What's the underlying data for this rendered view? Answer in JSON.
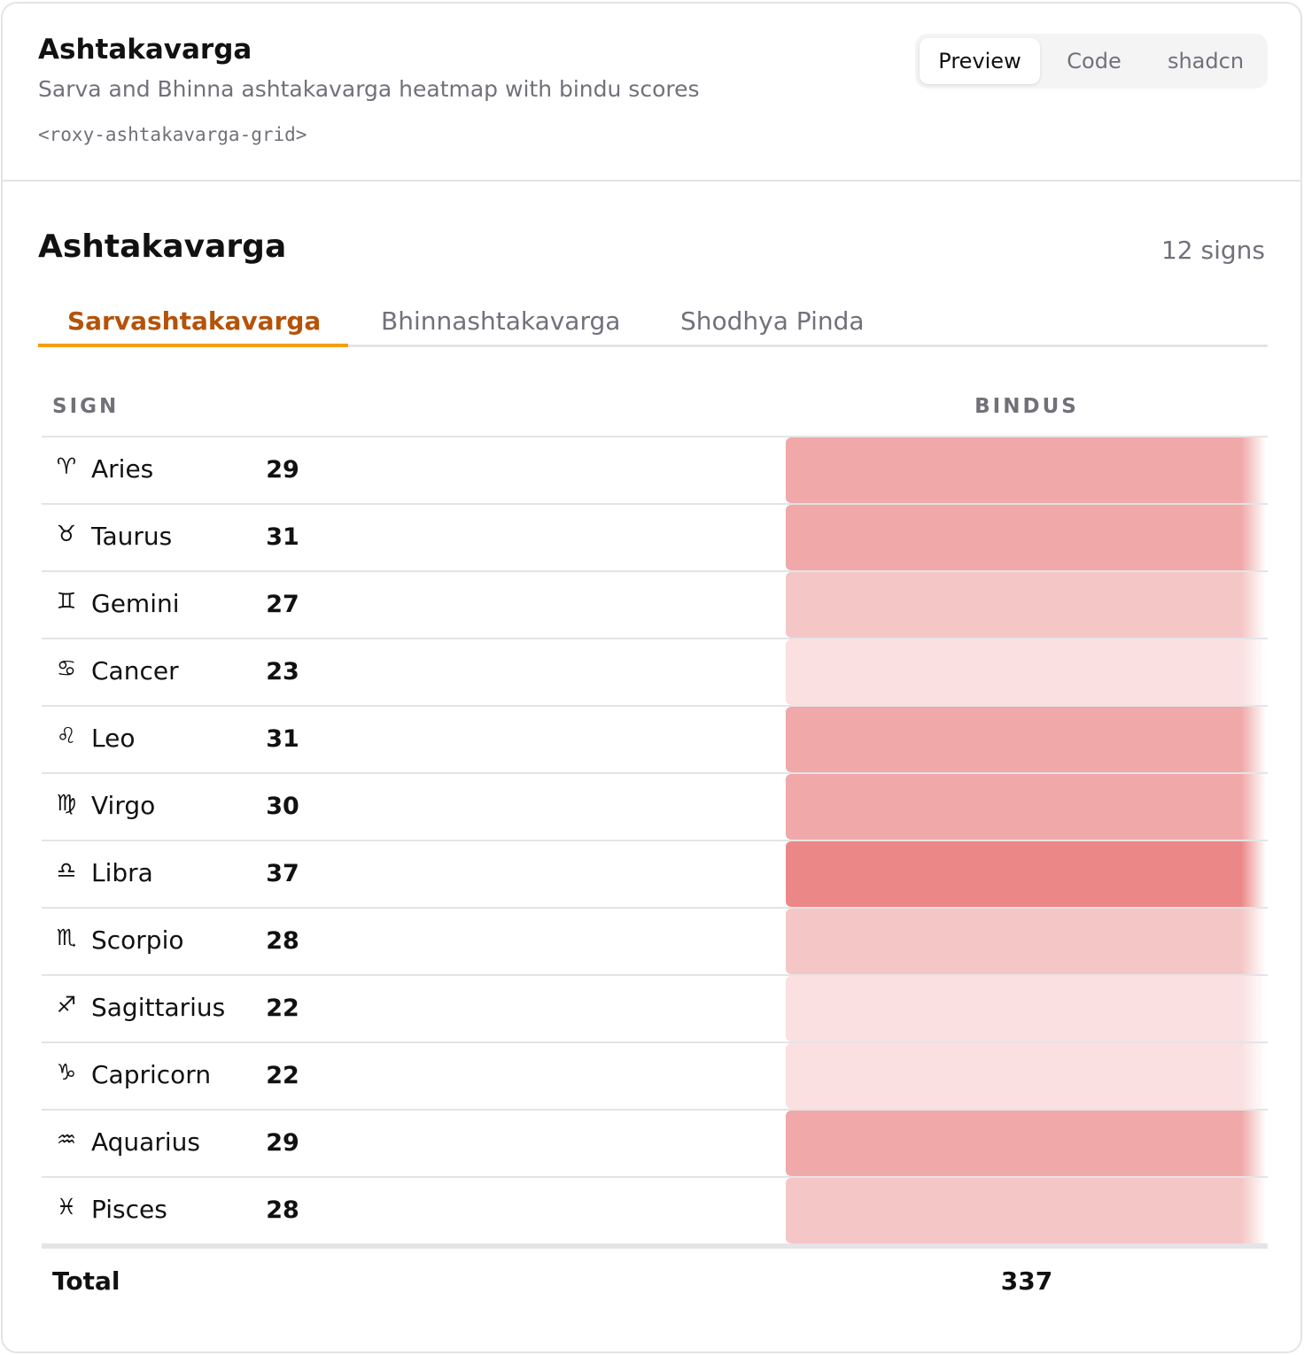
{
  "header": {
    "title": "Ashtakavarga",
    "description": "Sarva and Bhinna ashtakavarga heatmap with bindu scores",
    "tag": "<roxy-ashtakavarga-grid>",
    "view_tabs": [
      "Preview",
      "Code",
      "shadcn"
    ],
    "active_view": "Preview"
  },
  "widget": {
    "title": "Ashtakavarga",
    "count_label": "12 signs",
    "tabs": [
      "Sarvashtakavarga",
      "Bhinnashtakavarga",
      "Shodhya Pinda"
    ],
    "active_tab": "Sarvashtakavarga",
    "columns": {
      "sign": "SIGN",
      "bindus": "BINDUS"
    },
    "rows": [
      {
        "glyph": "♈",
        "sign": "Aries",
        "bindus": "29",
        "color": "#f0a8a8"
      },
      {
        "glyph": "♉",
        "sign": "Taurus",
        "bindus": "31",
        "color": "#f0a8a8"
      },
      {
        "glyph": "♊",
        "sign": "Gemini",
        "bindus": "27",
        "color": "#f5c6c6"
      },
      {
        "glyph": "♋",
        "sign": "Cancer",
        "bindus": "23",
        "color": "#fae0e0"
      },
      {
        "glyph": "♌",
        "sign": "Leo",
        "bindus": "31",
        "color": "#f0a8a8"
      },
      {
        "glyph": "♍",
        "sign": "Virgo",
        "bindus": "30",
        "color": "#f0a8a8"
      },
      {
        "glyph": "♎",
        "sign": "Libra",
        "bindus": "37",
        "color": "#ec8787"
      },
      {
        "glyph": "♏",
        "sign": "Scorpio",
        "bindus": "28",
        "color": "#f5c6c6"
      },
      {
        "glyph": "♐",
        "sign": "Sagittarius",
        "bindus": "22",
        "color": "#fae0e0"
      },
      {
        "glyph": "♑",
        "sign": "Capricorn",
        "bindus": "22",
        "color": "#fae0e0"
      },
      {
        "glyph": "♒",
        "sign": "Aquarius",
        "bindus": "29",
        "color": "#f0a8a8"
      },
      {
        "glyph": "♓",
        "sign": "Pisces",
        "bindus": "28",
        "color": "#f5c6c6"
      }
    ],
    "total_label": "Total",
    "total_value": "337"
  }
}
